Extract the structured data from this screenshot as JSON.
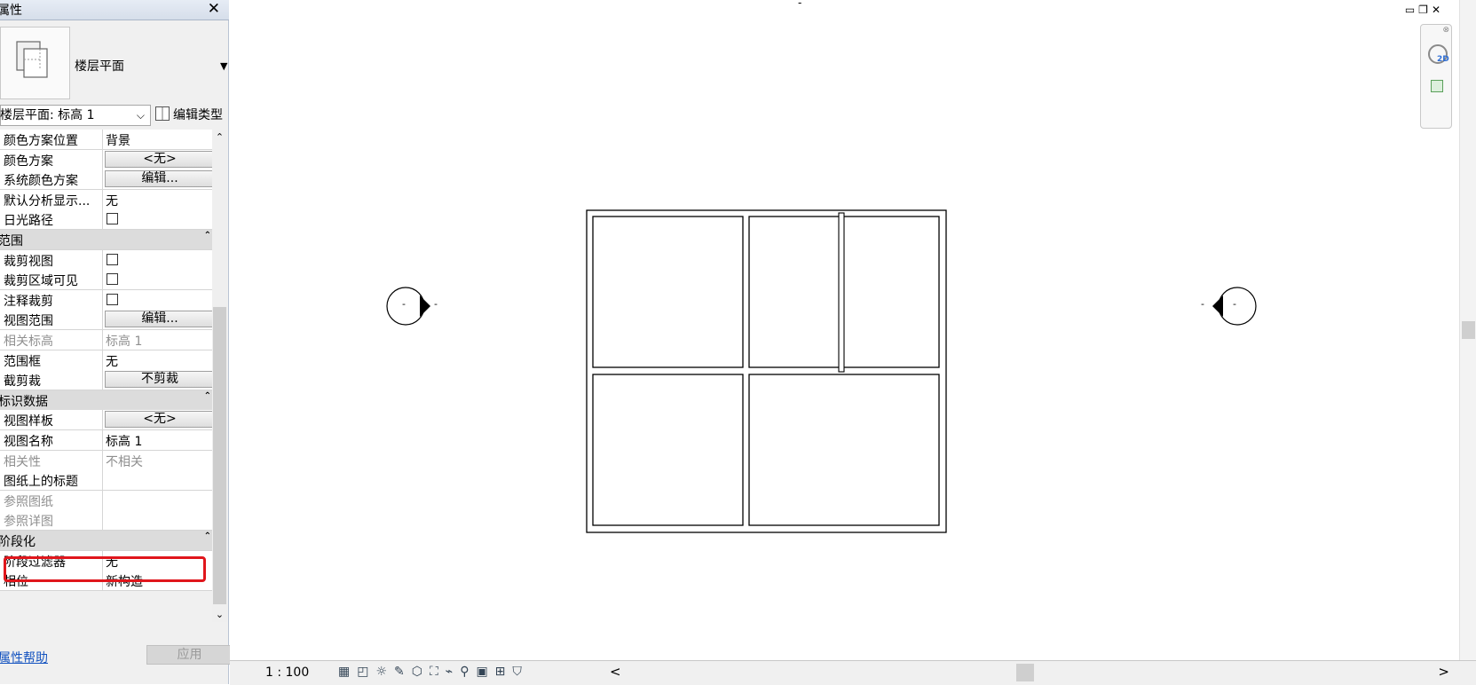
{
  "properties_panel": {
    "title": "属性",
    "close_label": "✕",
    "type_name": "楼层平面",
    "type_dropdown_glyph": "▼",
    "instance_selector": "楼层平面: 标高 1",
    "edit_type_label": "编辑类型",
    "help_link": "属性帮助",
    "apply_button": "应用",
    "rows": [
      {
        "kind": "prop",
        "name": "颜色方案位置",
        "value": "背景",
        "control": "text"
      },
      {
        "kind": "prop",
        "name": "颜色方案",
        "value": "<无>",
        "control": "button"
      },
      {
        "kind": "prop",
        "name": "系统颜色方案",
        "value": "编辑...",
        "control": "button"
      },
      {
        "kind": "prop",
        "name": "默认分析显示...",
        "value": "无",
        "control": "text"
      },
      {
        "kind": "prop",
        "name": "日光路径",
        "value": "",
        "control": "checkbox"
      },
      {
        "kind": "group",
        "name": "范围",
        "chevron": "⌃"
      },
      {
        "kind": "prop",
        "name": "裁剪视图",
        "value": "",
        "control": "checkbox"
      },
      {
        "kind": "prop",
        "name": "裁剪区域可见",
        "value": "",
        "control": "checkbox"
      },
      {
        "kind": "prop",
        "name": "注释裁剪",
        "value": "",
        "control": "checkbox"
      },
      {
        "kind": "prop",
        "name": "视图范围",
        "value": "编辑...",
        "control": "button"
      },
      {
        "kind": "prop",
        "name": "相关标高",
        "value": "标高 1",
        "control": "text",
        "disabled": true
      },
      {
        "kind": "prop",
        "name": "范围框",
        "value": "无",
        "control": "text"
      },
      {
        "kind": "prop",
        "name": "截剪裁",
        "value": "不剪裁",
        "control": "button"
      },
      {
        "kind": "group",
        "name": "标识数据",
        "chevron": "⌃"
      },
      {
        "kind": "prop",
        "name": "视图样板",
        "value": "<无>",
        "control": "button"
      },
      {
        "kind": "prop",
        "name": "视图名称",
        "value": "标高 1",
        "control": "text"
      },
      {
        "kind": "prop",
        "name": "相关性",
        "value": "不相关",
        "control": "text",
        "disabled": true
      },
      {
        "kind": "prop",
        "name": "图纸上的标题",
        "value": "",
        "control": "text"
      },
      {
        "kind": "prop",
        "name": "参照图纸",
        "value": "",
        "control": "text",
        "disabled": true
      },
      {
        "kind": "prop",
        "name": "参照详图",
        "value": "",
        "control": "text",
        "disabled": true
      },
      {
        "kind": "group",
        "name": "阶段化",
        "chevron": "⌃"
      },
      {
        "kind": "prop",
        "name": "阶段过滤器",
        "value": "无",
        "control": "text",
        "highlighted": true
      },
      {
        "kind": "prop",
        "name": "相位",
        "value": "新构造",
        "control": "text"
      }
    ]
  },
  "view": {
    "scale": "1 : 100",
    "window_controls": "▭❐✕",
    "status_icons": "▦◰☼✎⬡⛶⌁⚲▣⊞⛉",
    "left_arrow": "<",
    "right_arrow": ">",
    "elevation_marker_text": "-",
    "top_mark": "-",
    "nav_2d_label": "2D"
  }
}
